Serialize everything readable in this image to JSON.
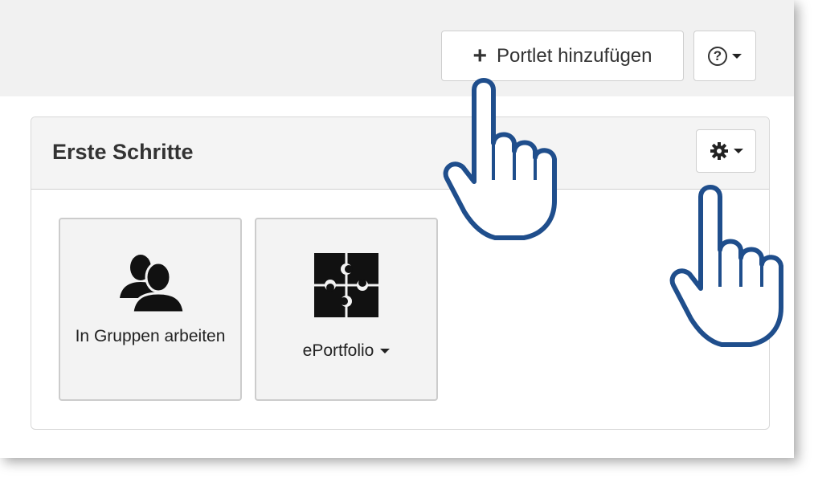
{
  "toolbar": {
    "add_portlet_label": "Portlet hinzufügen",
    "add_icon": "plus-icon",
    "help_icon": "question-circle-icon",
    "help_glyph": "?"
  },
  "panel": {
    "title": "Erste Schritte",
    "settings_icon": "gear-icon",
    "tiles": [
      {
        "label": "In Gruppen arbeiten",
        "icon": "users-icon"
      },
      {
        "label": "ePortfolio",
        "icon": "puzzle-icon",
        "has_dropdown": true
      }
    ]
  },
  "colors": {
    "toolbar_bg": "#f1f1f1",
    "panel_header_bg": "#f4f4f4",
    "tile_bg": "#f3f3f3",
    "hand_outline": "#1f4e8c"
  }
}
